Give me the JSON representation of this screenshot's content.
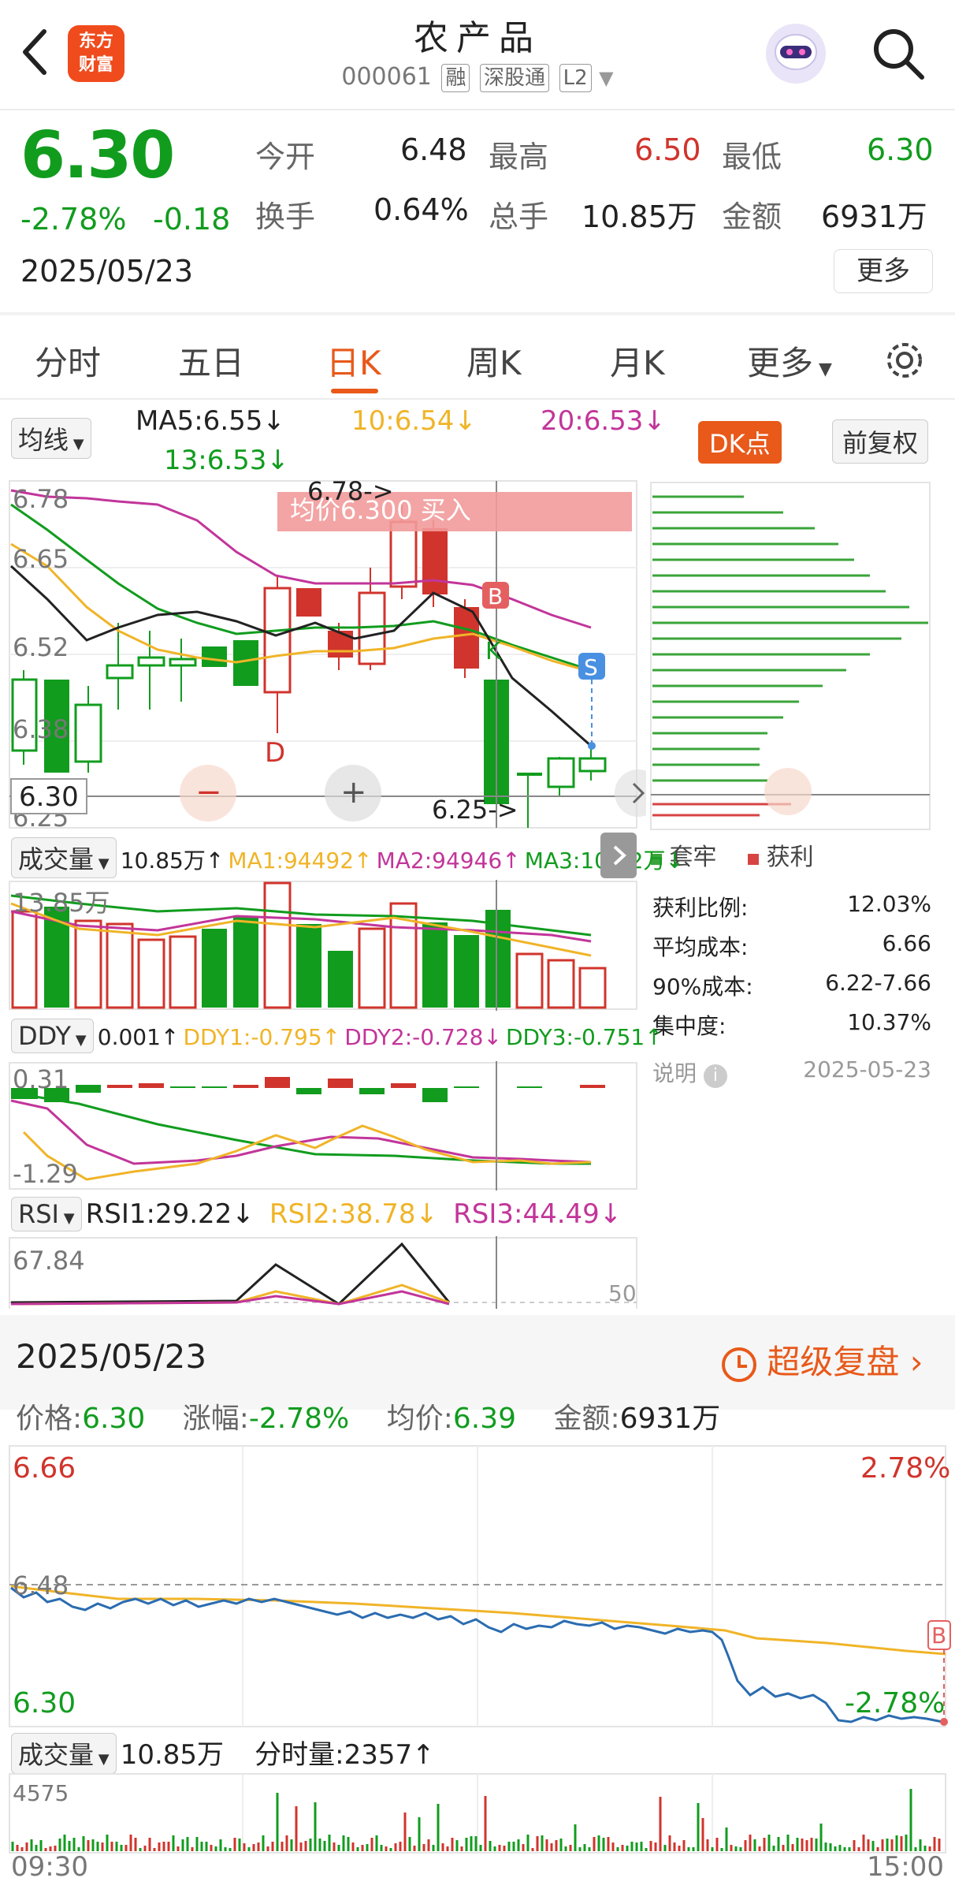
{
  "header": {
    "title": "农产品",
    "code": "000061",
    "tags": [
      "融",
      "深股通",
      "L2"
    ],
    "logo_text": [
      "东方",
      "财富"
    ]
  },
  "quote": {
    "price": "6.30",
    "change_pct": "-2.78%",
    "change": "-0.18",
    "date": "2025/05/23",
    "fields": [
      {
        "label": "今开",
        "value": "6.48",
        "color": "default"
      },
      {
        "label": "最高",
        "value": "6.50",
        "color": "red"
      },
      {
        "label": "最低",
        "value": "6.30",
        "color": "green"
      },
      {
        "label": "换手",
        "value": "0.64%",
        "color": "default"
      },
      {
        "label": "总手",
        "value": "10.85万",
        "color": "default"
      },
      {
        "label": "金额",
        "value": "6931万",
        "color": "default"
      }
    ],
    "more_button": "更多"
  },
  "tabs": [
    "分时",
    "五日",
    "日K",
    "周K",
    "月K",
    "更多"
  ],
  "active_tab": "日K",
  "ma_bar": {
    "selector": "均线",
    "ma5": "MA5:6.55↓",
    "ma10": "10:6.54↓",
    "ma20": "20:6.53↓",
    "ma13": "13:6.53↓",
    "dk_button": "DK点",
    "fq_button": "前复权"
  },
  "kline": {
    "y_labels": [
      "6.78",
      "6.65",
      "6.52",
      "6.38",
      "6.25"
    ],
    "crosshair_price": "6.30",
    "high_marker": "6.78->",
    "low_marker": "6.25->",
    "avg_banner": "均价6.300 买入",
    "signals": {
      "b": "B",
      "s": "S",
      "d": "D",
      "k": "K"
    }
  },
  "chip": {
    "legend_trapped": "套牢",
    "legend_profit": "获利",
    "stats": [
      {
        "label": "获利比例:",
        "value": "12.03%"
      },
      {
        "label": "平均成本:",
        "value": "6.66"
      },
      {
        "label": "90%成本:",
        "value": "6.22-7.66"
      },
      {
        "label": "集中度:",
        "value": "10.37%"
      }
    ],
    "note_label": "说明",
    "note_date": "2025-05-23"
  },
  "volume_panel": {
    "selector": "成交量",
    "vol": "10.85万↑",
    "ma1": "MA1:94492↑",
    "ma2": "MA2:94946↑",
    "ma3": "MA3:10.52万↓",
    "y_top": "13.85万"
  },
  "ddy_panel": {
    "selector": "DDY",
    "value": "0.001↑",
    "ddy1": "DDY1:-0.795↑",
    "ddy2": "DDY2:-0.728↓",
    "ddy3": "DDY3:-0.751↑",
    "y_top": "0.31",
    "y_bottom": "-1.29"
  },
  "rsi_panel": {
    "selector": "RSI",
    "rsi1": "RSI1:29.22↓",
    "rsi2": "RSI2:38.78↓",
    "rsi3": "RSI3:44.49↓",
    "y_top": "67.84",
    "mid": "50"
  },
  "intraday": {
    "date": "2025/05/23",
    "super_review": "超级复盘",
    "price_label": "价格:",
    "price": "6.30",
    "change_label": "涨幅:",
    "change": "-2.78%",
    "avg_label": "均价:",
    "avg": "6.39",
    "amount_label": "金额:",
    "amount": "6931万",
    "y_top": "6.66",
    "y_mid": "6.48",
    "y_bottom": "6.30",
    "pct_top": "2.78%",
    "pct_bottom": "-2.78%",
    "b_marker": "B",
    "vol_selector": "成交量",
    "vol_total": "10.85万",
    "vol_minute_label": "分时量:",
    "vol_minute": "2357↑",
    "vol_y_top": "4575",
    "time_start": "09:30",
    "time_end": "15:00"
  },
  "colors": {
    "up": "#d0342c",
    "down": "#119c1e",
    "accent": "#e8591a",
    "ma5": "#222222",
    "ma10": "#f0b428",
    "ma20": "#c2359a",
    "ma13": "#119c1e",
    "price_line": "#2b6cb0",
    "avg_line": "#f0b428"
  }
}
